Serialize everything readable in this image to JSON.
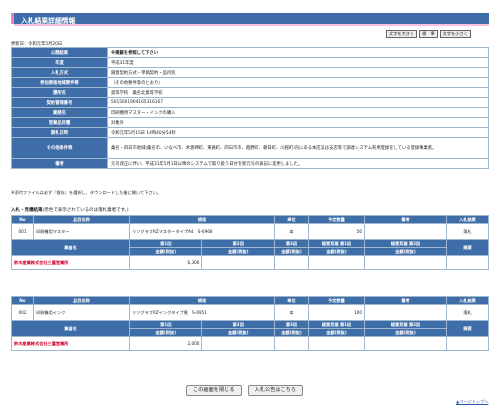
{
  "page_title": "入札結果詳細情報",
  "font_buttons": [
    "文字を大きく",
    "標　準",
    "文字を小さく"
  ],
  "updated": "更新日：令和元年5月20日",
  "info_rows": [
    {
      "label": "公開結果",
      "value": "※掲載を参照して下さい",
      "bold": true
    },
    {
      "label": "年度",
      "value": "平成31年度"
    },
    {
      "label": "入札方式",
      "value": "随意契約方式・単価契約・品目別"
    },
    {
      "label": "参加資格地域要件等",
      "value": "（その他要件等のとおり）"
    },
    {
      "label": "課所名",
      "value": "奥等学校　桑名北奥等学校"
    },
    {
      "label": "契約管理番号",
      "value": "5015001904165316167"
    },
    {
      "label": "業務名",
      "value": "印刷機用マスター・インクの購入"
    },
    {
      "label": "営業品目種",
      "value": "対象外"
    },
    {
      "label": "開札日時",
      "value": "令和元年5月15日 14時40分54秒"
    },
    {
      "label": "その他条件等",
      "value": "桑名・四日市地域(桑名市、いなべ市、木曽岬町、東員町、四日市市、菰野町、朝日町、川越町)内にある本店又は支店等で調達システム利用登録をしている登録事業者。",
      "tall": true
    },
    {
      "label": "備考",
      "value": "元号改正に伴い、平成31年5月1日以降のシステムで取り扱う日付を新元号の表記に変更しました。"
    }
  ],
  "note": "※添付ファイルは必ず『保存』を選択し、ダウンロードした後に開いて下さい。",
  "section_title": "入札・見積結果",
  "section_sub": "(赤色で表示されているのは落札業者です。)",
  "headers": {
    "no": "No",
    "item": "品目名称",
    "spec": "規格",
    "unit": "単位",
    "qty": "予定数量",
    "remark": "備考",
    "winner": "入札結果",
    "company": "業者名",
    "r1": "第1回",
    "r2": "第2回",
    "r3": "第3回",
    "rv1": "随意見積\n第1回",
    "rv2": "随意見積\n第2回",
    "summary": "摘要",
    "amount": "金額(税抜)"
  },
  "items": [
    {
      "no": "001",
      "name": "印刷機用マスター",
      "spec": "リソグラフRZマスタータイプA4　S-6968",
      "unit": "本",
      "qty": "50",
      "remark": "",
      "result": "落札",
      "company": "鈴木産業株式会社三重営業所",
      "amount1": "6,300",
      "amount2": "",
      "amount3": "",
      "amount4": "",
      "amount5": "",
      "summary": ""
    },
    {
      "no": "002",
      "name": "印刷機用インク",
      "spec": "リソグラフRZインクタイプ黒　S-6951",
      "unit": "本",
      "qty": "100",
      "remark": "",
      "result": "落札",
      "company": "鈴木産業株式会社三重営業所",
      "amount1": "2,000",
      "amount2": "",
      "amount3": "",
      "amount4": "",
      "amount5": "",
      "summary": ""
    }
  ],
  "buttons": {
    "close": "この画面を閉じる",
    "notice": "入札公告はこちら"
  },
  "top_link": "▲ページトップへ",
  "colors": {
    "header_blue": "#3f6da8",
    "accent_pink": "#f07fc0",
    "winner_red": "#d0002a"
  }
}
